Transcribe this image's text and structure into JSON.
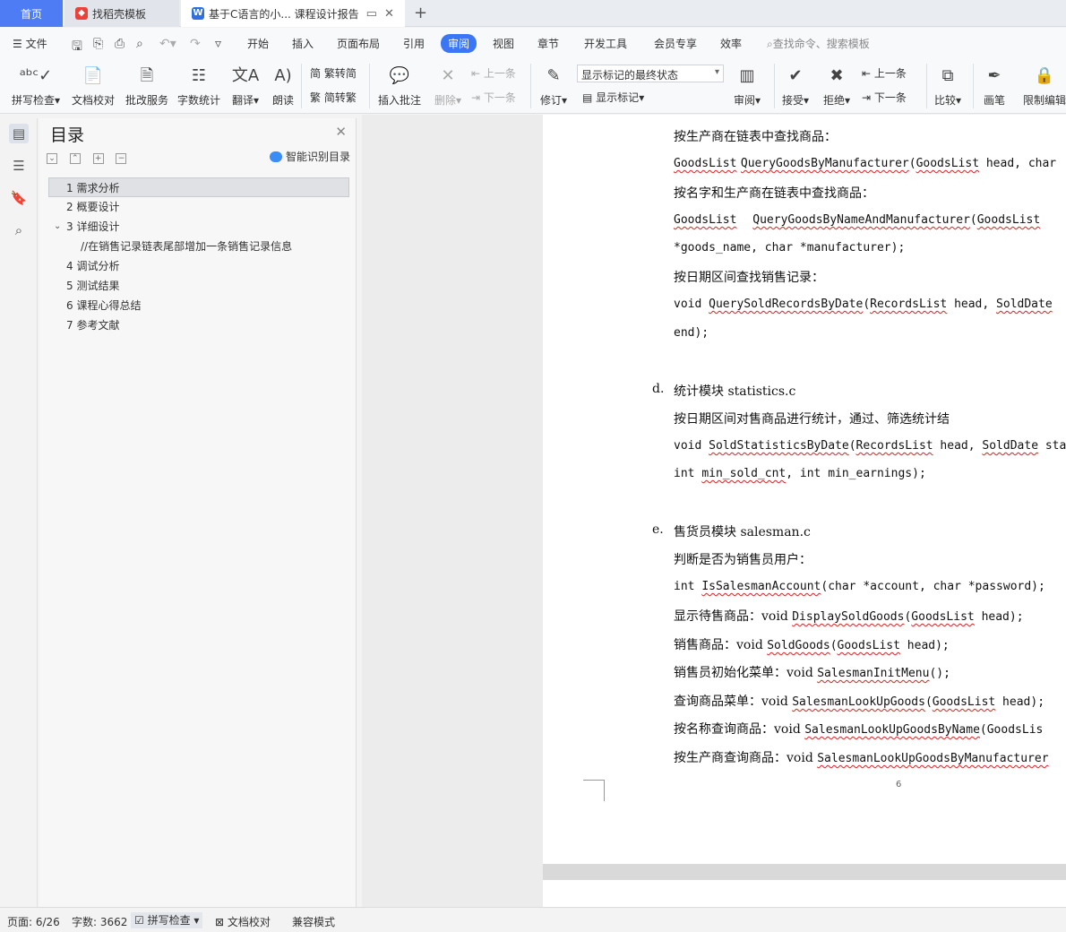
{
  "tabs": {
    "home": "首页",
    "tab1": "找稻壳模板",
    "tab2": "基于C语言的小... 课程设计报告"
  },
  "menu": {
    "file": "文件",
    "items": [
      "开始",
      "插入",
      "页面布局",
      "引用",
      "审阅",
      "视图",
      "章节",
      "开发工具",
      "会员专享",
      "效率"
    ],
    "active": "审阅",
    "search_placeholder": "查找命令、搜索模板"
  },
  "ribbon": {
    "spell_check": "拼写检查",
    "doc_proof": "文档校对",
    "review_service": "批改服务",
    "word_count": "字数统计",
    "translate": "翻译",
    "read_aloud": "朗读",
    "trad_to_simp": "繁转简",
    "simp_to_trad": "简转繁",
    "insert_comment": "插入批注",
    "delete": "删除",
    "prev_comment": "上一条",
    "next_comment": "下一条",
    "track_changes": "修订",
    "markup_state": "显示标记的最终状态",
    "show_markup": "显示标记",
    "review": "审阅",
    "accept": "接受",
    "reject": "拒绝",
    "prev": "上一条",
    "next": "下一条",
    "compare": "比较",
    "pen": "画笔",
    "restrict_edit": "限制编辑"
  },
  "toc": {
    "title": "目录",
    "smart": "智能识别目录",
    "items": [
      {
        "label": "1 需求分析"
      },
      {
        "label": "2 概要设计"
      },
      {
        "label": "3 详细设计"
      },
      {
        "label": "//在销售记录链表尾部增加一条销售记录信息"
      },
      {
        "label": "4 调试分析"
      },
      {
        "label": "5 测试结果"
      },
      {
        "label": "6 课程心得总结"
      },
      {
        "label": "7 参考文献"
      }
    ]
  },
  "document": {
    "l1": "按生产商在链表中查找商品：",
    "l2a": "GoodsList",
    "l2b": "QueryGoodsByManufacturer",
    "l2c": "(",
    "l2d": "GoodsList",
    "l2e": " head, char",
    "l3": "按名字和生产商在链表中查找商品：",
    "l4a": "GoodsList",
    "l4b": "QueryGoodsByNameAndManufacturer",
    "l4c": "(",
    "l4d": "GoodsList",
    "l5": "*goods_name, char *manufacturer);",
    "l6": "按日期区间查找销售记录：",
    "l7a": "void ",
    "l7b": "QuerySoldRecordsByDate",
    "l7c": "(",
    "l7d": "RecordsList",
    "l7e": " head, ",
    "l7f": "SoldDate",
    "l8": "end);",
    "d_label": "d.",
    "d_title": "统计模块 statistics.c",
    "l9": "按日期区间对售商品进行统计，通过、筛选统计结",
    "l10a": "void ",
    "l10b": "SoldStatisticsByDate",
    "l10c": "(",
    "l10d": "RecordsList",
    "l10e": " head, ",
    "l10f": "SoldDate",
    "l10g": " sta",
    "l11a": "int ",
    "l11b": "min_sold_cnt",
    "l11c": ", int min_earnings);",
    "e_label": "e.",
    "e_title": "售货员模块 salesman.c",
    "l12": "判断是否为销售员用户：",
    "l13a": "int ",
    "l13b": "IsSalesmanAccount",
    "l13c": "(char *account, char *password);",
    "l14a": "显示待售商品：void ",
    "l14b": "DisplaySoldGoods",
    "l14c": "(",
    "l14d": "GoodsList",
    "l14e": " head);",
    "l15a": "销售商品：void ",
    "l15b": "SoldGoods",
    "l15c": "(",
    "l15d": "GoodsList",
    "l15e": " head);",
    "l16a": "销售员初始化菜单：void ",
    "l16b": "SalesmanInitMenu",
    "l16c": "();",
    "l17a": "查询商品菜单：void ",
    "l17b": "SalesmanLookUpGoods",
    "l17c": "(",
    "l17d": "GoodsList",
    "l17e": " head);",
    "l18a": "按名称查询商品：void ",
    "l18b": "SalesmanLookUpGoodsByName",
    "l18c": "(GoodsLis",
    "l19a": "按生产商查询商品：void ",
    "l19b": "SalesmanLookUpGoodsByManufacturer",
    "page_number": "6"
  },
  "status": {
    "page": "页面: 6/26",
    "words": "字数: 3662",
    "spell": "拼写检查",
    "proof": "文档校对",
    "compat": "兼容模式"
  },
  "colors": {
    "accent": "#3b76f6",
    "home_tab": "#4d7cf4",
    "spell_underline": "#e02020"
  }
}
